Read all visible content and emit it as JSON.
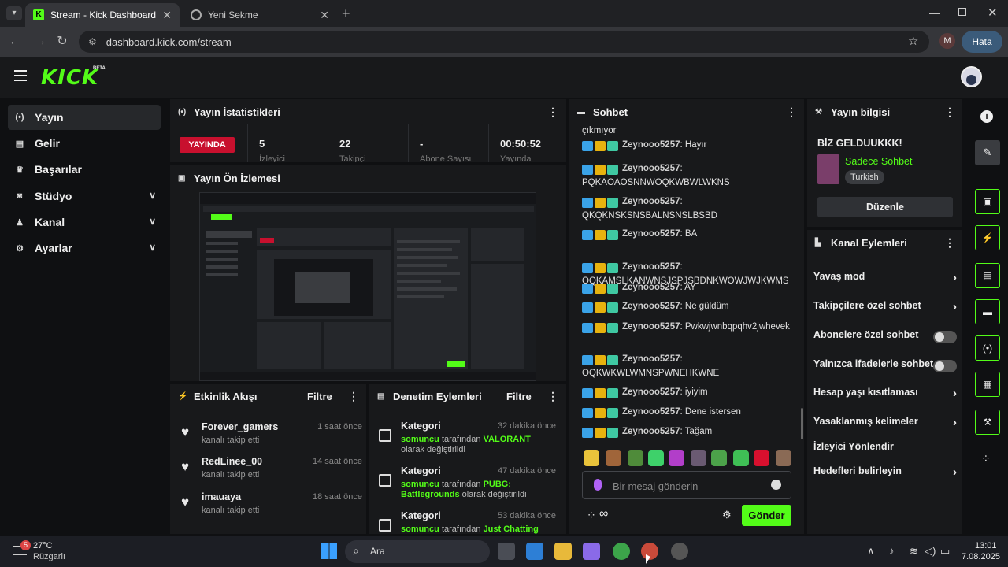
{
  "browser": {
    "tabs": [
      {
        "title": "Stream - Kick Dashboard",
        "active": true
      },
      {
        "title": "Yeni Sekme",
        "active": false
      }
    ],
    "url": "dashboard.kick.com/stream",
    "profile_initial": "M",
    "error_button": "Hata"
  },
  "header": {
    "logo": "KICK",
    "beta": "BETA"
  },
  "sidebar": {
    "items": [
      {
        "label": "Yayın",
        "icon": "broadcast-icon",
        "active": true,
        "expandable": false
      },
      {
        "label": "Gelir",
        "icon": "chart-icon",
        "active": false,
        "expandable": false
      },
      {
        "label": "Başarılar",
        "icon": "trophy-icon",
        "active": false,
        "expandable": false
      },
      {
        "label": "Stüdyo",
        "icon": "studio-icon",
        "active": false,
        "expandable": true
      },
      {
        "label": "Kanal",
        "icon": "users-icon",
        "active": false,
        "expandable": true
      },
      {
        "label": "Ayarlar",
        "icon": "gear-icon",
        "active": false,
        "expandable": true
      }
    ]
  },
  "stats": {
    "title": "Yayın İstatistikleri",
    "live_badge": "YAYINDA",
    "cells": [
      {
        "value": "5",
        "label": "İzleyici"
      },
      {
        "value": "22",
        "label": "Takipçi"
      },
      {
        "value": "-",
        "label": "Abone Sayısı"
      },
      {
        "value": "00:50:52",
        "label": "Yayında"
      }
    ]
  },
  "preview": {
    "title": "Yayın Ön İzlemesi"
  },
  "activity": {
    "title": "Etkinlik Akışı",
    "filter": "Filtre",
    "items": [
      {
        "name": "Forever_gamers",
        "action": "kanalı takip etti",
        "time": "1 saat önce"
      },
      {
        "name": "RedLinee_00",
        "action": "kanalı takip etti",
        "time": "14 saat önce"
      },
      {
        "name": "imauaya",
        "action": "kanalı takip etti",
        "time": "18 saat önce"
      }
    ]
  },
  "moderation": {
    "title": "Denetim Eylemleri",
    "filter": "Filtre",
    "items": [
      {
        "title": "Kategori",
        "time": "32 dakika önce",
        "user": "somuncu",
        "mid": " tarafından ",
        "value": "VALORANT",
        "tail": " olarak değiştirildi"
      },
      {
        "title": "Kategori",
        "time": "47 dakika önce",
        "user": "somuncu",
        "mid": " tarafından ",
        "value": "PUBG: Battlegrounds",
        "tail": " olarak değiştirildi"
      },
      {
        "title": "Kategori",
        "time": "53 dakika önce",
        "user": "somuncu",
        "mid": " tarafından ",
        "value": "Just Chatting",
        "tail": ""
      }
    ]
  },
  "chat": {
    "title": "Sohbet",
    "top_fragment": "çıkmıyor",
    "messages": [
      {
        "user": "Zeynooo5257",
        "text": "Hayır"
      },
      {
        "user": "Zeynooo5257",
        "text": "PQKAOAOSNNWOQKWBWLWKNS"
      },
      {
        "user": "Zeynooo5257",
        "text": "QKQKNSKSNSBALNSNSLBSBD"
      },
      {
        "user": "Zeynooo5257",
        "text": "BA"
      },
      {
        "user": "Zeynooo5257",
        "text": "OQKAMSLKANWNSJSPJSBDNKWOWJWJKWMS"
      },
      {
        "user": "Zeynooo5257",
        "text": "AY"
      },
      {
        "user": "Zeynooo5257",
        "text": "Ne güldüm"
      },
      {
        "user": "Zeynooo5257",
        "text": "Pwkwjwnbqpqhv2jwhevek"
      },
      {
        "user": "Zeynooo5257",
        "text": "OQKWKWLWMNSPWNEHKWNE"
      },
      {
        "user": "Zeynooo5257",
        "text": "iyiyim"
      },
      {
        "user": "Zeynooo5257",
        "text": "Dene istersen"
      },
      {
        "user": "Zeynooo5257",
        "text": "Tağam"
      }
    ],
    "input_placeholder": "Bir mesaj gönderin",
    "send_label": "Gönder"
  },
  "stream_info": {
    "title": "Yayın bilgisi",
    "stream_title": "BİZ GELDUUKKK!",
    "category": "Sadece Sohbet",
    "language": "Turkish",
    "edit_label": "Düzenle"
  },
  "channel_actions": {
    "title": "Kanal Eylemleri",
    "items": [
      {
        "label": "Yavaş mod",
        "control": "arrow"
      },
      {
        "label": "Takipçilere özel sohbet",
        "control": "arrow"
      },
      {
        "label": "Abonelere özel sohbet",
        "control": "toggle"
      },
      {
        "label": "Yalnızca ifadelerle sohbet",
        "control": "toggle"
      },
      {
        "label": "Hesap yaşı kısıtlaması",
        "control": "arrow"
      },
      {
        "label": "Yasaklanmış kelimeler",
        "control": "arrow"
      },
      {
        "label": "İzleyici Yönlendir",
        "control": "none"
      },
      {
        "label": "Hedefleri belirleyin",
        "control": "arrow"
      }
    ]
  },
  "taskbar": {
    "weather_temp": "27°C",
    "weather_desc": "Rüzgarlı",
    "weather_badge": "5",
    "search_label": "Ara",
    "time": "13:01",
    "date": "7.08.2025"
  },
  "colors": {
    "brand": "#53fc18",
    "live": "#c8102e",
    "panel": "#18191b"
  }
}
